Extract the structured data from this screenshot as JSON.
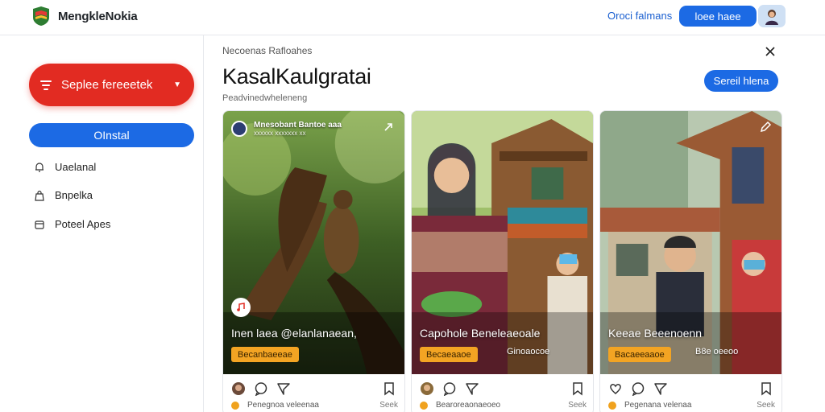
{
  "header": {
    "brand": "MengkleNokia",
    "link": "Oroci falmans",
    "button": "loee haee"
  },
  "sidebar": {
    "primary_button": "Seplee fereeetek",
    "install_button": "OInstal",
    "items": [
      {
        "label": "Uaelanal",
        "icon": "bell-icon"
      },
      {
        "label": "Bnpelka",
        "icon": "bag-icon"
      },
      {
        "label": "Poteel Apes",
        "icon": "box-icon"
      }
    ]
  },
  "main": {
    "section_label": "Necoenas Rafloahes",
    "title": "KasalKaulgratai",
    "subtitle": "Peadvinedwheleneng",
    "action_button": "Sereil hlena",
    "cards": [
      {
        "header_name": "Mnesobant Bantoe aaa",
        "header_meta": "xxxxxx xxxxxxx xx",
        "caption": "Inen laea @elanlanaean,",
        "tag": "Becanbaeeae",
        "extra": "",
        "footer": "Penegnoa veleenaa",
        "footer_right": "Seek"
      },
      {
        "header_name": "",
        "header_meta": "",
        "caption": "Capohole Beneleaeoale",
        "tag": "Becaeaaoe",
        "extra": "Ginoaocoe",
        "footer": "Bearoreaonaeoeo",
        "footer_right": "Seek"
      },
      {
        "header_name": "",
        "header_meta": "",
        "caption": "Keeae Beeenoenn",
        "tag": "Bacaeeaaoe",
        "extra": "B8e oeeoo",
        "footer": "Pegenana velenaa",
        "footer_right": "Seek"
      }
    ]
  },
  "colors": {
    "primary_red": "#e22b22",
    "primary_blue": "#1c6ae4",
    "tag_orange": "#f3a423"
  }
}
